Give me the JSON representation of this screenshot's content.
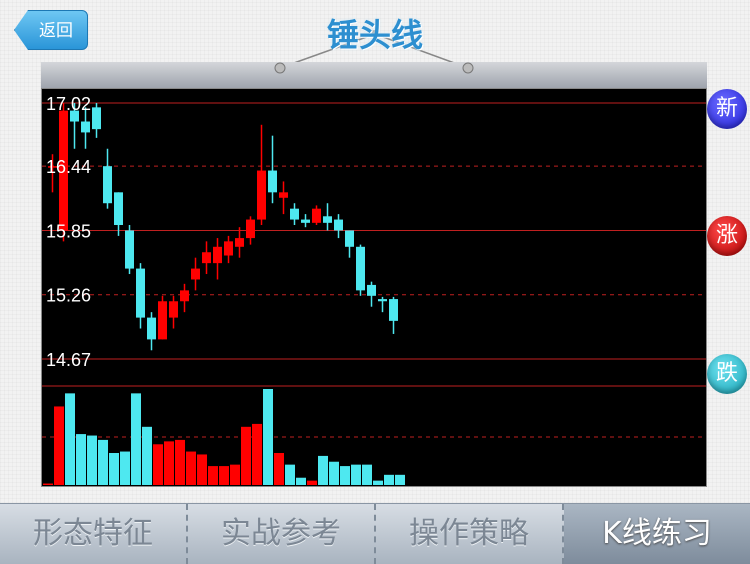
{
  "header": {
    "back_label": "返回",
    "title": "锤头线"
  },
  "side_buttons": {
    "new": "新",
    "up": "涨",
    "down": "跌"
  },
  "tabs": [
    {
      "label": "形态特征",
      "active": false
    },
    {
      "label": "实战参考",
      "active": false
    },
    {
      "label": "操作策略",
      "active": false
    },
    {
      "label": "K线练习",
      "active": true
    }
  ],
  "colors": {
    "up": "#ff0000",
    "down": "#4ee8f0",
    "grid": "#c02020"
  },
  "chart_data": {
    "type": "candlestick",
    "y_ticks": [
      "17.02",
      "16.44",
      "15.85",
      "15.26",
      "14.67"
    ],
    "ylim": [
      14.67,
      17.02
    ],
    "candles": [
      {
        "o": 16.44,
        "c": 16.44,
        "h": 16.55,
        "l": 16.2
      },
      {
        "o": 15.85,
        "c": 16.95,
        "h": 17.02,
        "l": 15.75
      },
      {
        "o": 16.95,
        "c": 16.85,
        "h": 17.02,
        "l": 16.6
      },
      {
        "o": 16.85,
        "c": 16.75,
        "h": 16.98,
        "l": 16.6
      },
      {
        "o": 16.98,
        "c": 16.78,
        "h": 17.02,
        "l": 16.7
      },
      {
        "o": 16.44,
        "c": 16.1,
        "h": 16.6,
        "l": 16.05
      },
      {
        "o": 16.2,
        "c": 15.9,
        "h": 16.2,
        "l": 15.8
      },
      {
        "o": 15.85,
        "c": 15.5,
        "h": 15.9,
        "l": 15.45
      },
      {
        "o": 15.5,
        "c": 15.05,
        "h": 15.55,
        "l": 14.95
      },
      {
        "o": 15.05,
        "c": 14.85,
        "h": 15.1,
        "l": 14.75
      },
      {
        "o": 14.85,
        "c": 15.2,
        "h": 15.25,
        "l": 14.85
      },
      {
        "o": 15.05,
        "c": 15.2,
        "h": 15.25,
        "l": 14.95
      },
      {
        "o": 15.2,
        "c": 15.3,
        "h": 15.36,
        "l": 15.1
      },
      {
        "o": 15.4,
        "c": 15.5,
        "h": 15.6,
        "l": 15.3
      },
      {
        "o": 15.55,
        "c": 15.65,
        "h": 15.75,
        "l": 15.45
      },
      {
        "o": 15.55,
        "c": 15.7,
        "h": 15.78,
        "l": 15.4
      },
      {
        "o": 15.62,
        "c": 15.75,
        "h": 15.8,
        "l": 15.55
      },
      {
        "o": 15.7,
        "c": 15.78,
        "h": 15.88,
        "l": 15.6
      },
      {
        "o": 15.78,
        "c": 15.95,
        "h": 15.98,
        "l": 15.72
      },
      {
        "o": 15.95,
        "c": 16.4,
        "h": 16.82,
        "l": 15.9
      },
      {
        "o": 16.4,
        "c": 16.2,
        "h": 16.72,
        "l": 16.1
      },
      {
        "o": 16.15,
        "c": 16.2,
        "h": 16.3,
        "l": 16.0
      },
      {
        "o": 16.05,
        "c": 15.95,
        "h": 16.1,
        "l": 15.9
      },
      {
        "o": 15.95,
        "c": 15.92,
        "h": 16.0,
        "l": 15.88
      },
      {
        "o": 15.92,
        "c": 16.05,
        "h": 16.08,
        "l": 15.9
      },
      {
        "o": 15.98,
        "c": 15.92,
        "h": 16.1,
        "l": 15.85
      },
      {
        "o": 15.95,
        "c": 15.85,
        "h": 16.0,
        "l": 15.78
      },
      {
        "o": 15.85,
        "c": 15.7,
        "h": 15.85,
        "l": 15.6
      },
      {
        "o": 15.7,
        "c": 15.3,
        "h": 15.72,
        "l": 15.25
      },
      {
        "o": 15.35,
        "c": 15.25,
        "h": 15.38,
        "l": 15.15
      },
      {
        "o": 15.22,
        "c": 15.2,
        "h": 15.24,
        "l": 15.1
      },
      {
        "o": 15.22,
        "c": 15.02,
        "h": 15.24,
        "l": 14.9
      }
    ],
    "volume": [
      1,
      54,
      63,
      35,
      34,
      31,
      22,
      23,
      63,
      40,
      28,
      30,
      31,
      23,
      21,
      13,
      13,
      14,
      40,
      42,
      66,
      22,
      14,
      5,
      3,
      20,
      16,
      13,
      14,
      14,
      3,
      7,
      7
    ]
  }
}
